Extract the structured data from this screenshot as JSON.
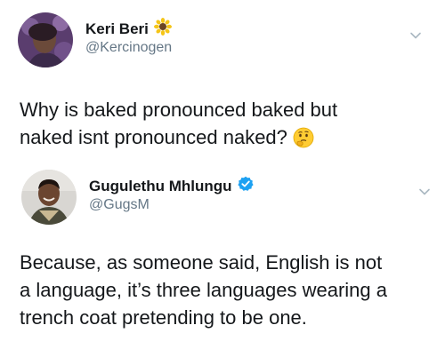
{
  "tweets": [
    {
      "author": {
        "display_name": "Keri Beri",
        "handle": "@Kercinogen",
        "name_badge_icon": "sunflower-emoji-icon"
      },
      "text_lines": [
        "Why is baked pronounced baked but",
        "naked isnt pronounced naked?"
      ],
      "trailing_emoji_icon": "thinking-face-emoji-icon",
      "menu_icon": "chevron-down-icon"
    },
    {
      "author": {
        "display_name": "Gugulethu Mhlungu",
        "handle": "@GugsM",
        "name_badge_icon": "verified-badge-icon"
      },
      "text_lines": [
        "Because, as someone said, English is not",
        "a language, it’s three languages wearing a",
        "trench coat pretending to be one."
      ],
      "menu_icon": "chevron-down-icon"
    }
  ],
  "colors": {
    "text_primary": "#14171a",
    "text_secondary": "#657786",
    "verified_blue": "#1da1f2",
    "chevron_gray": "#aab8c2"
  }
}
